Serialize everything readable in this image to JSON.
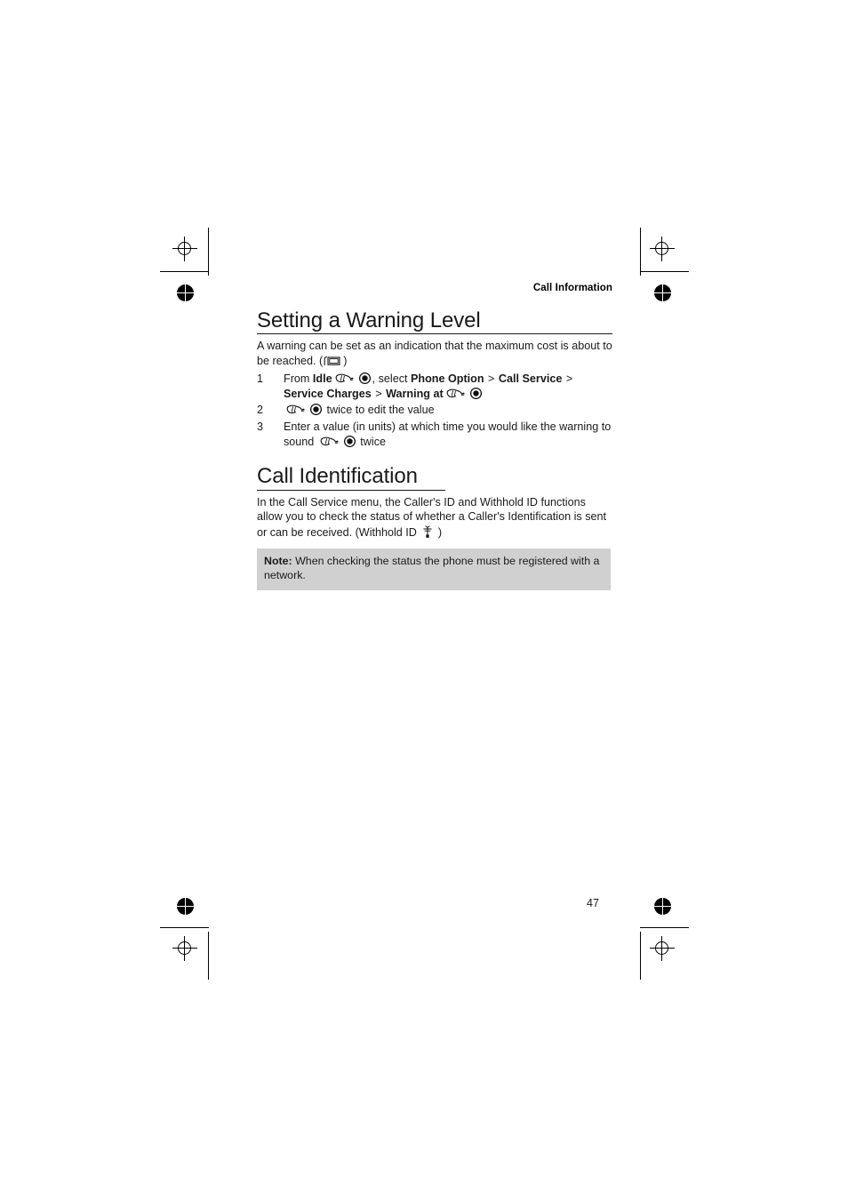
{
  "document": {
    "running_head": "Call Information",
    "page_number": "47"
  },
  "sections": [
    {
      "id": "setting-warning-level",
      "heading": "Setting a Warning Level",
      "intro_prefix": "A warning can be set as an indication that the maximum cost is about to be reached. (",
      "intro_icon": "display-icon",
      "intro_suffix": ")",
      "steps": [
        {
          "number": "1",
          "parts": [
            {
              "type": "text",
              "value": "From "
            },
            {
              "type": "bold",
              "value": "Idle"
            },
            {
              "type": "icon",
              "value": "scroll-icon"
            },
            {
              "type": "icon",
              "value": "select-icon"
            },
            {
              "type": "text",
              "value": ", select "
            },
            {
              "type": "bold",
              "value": "Phone Option"
            },
            {
              "type": "text",
              "value": " > "
            },
            {
              "type": "bold",
              "value": "Call Service"
            },
            {
              "type": "text",
              "value": " > "
            },
            {
              "type": "bold",
              "value": "Service Charges"
            },
            {
              "type": "text",
              "value": " > "
            },
            {
              "type": "bold",
              "value": "Warning at"
            },
            {
              "type": "icon",
              "value": "scroll-icon"
            },
            {
              "type": "icon",
              "value": "select-icon"
            }
          ]
        },
        {
          "number": "2",
          "parts": [
            {
              "type": "icon",
              "value": "scroll-icon"
            },
            {
              "type": "icon",
              "value": "select-icon"
            },
            {
              "type": "text",
              "value": " twice to edit the value"
            }
          ]
        },
        {
          "number": "3",
          "parts": [
            {
              "type": "text",
              "value": "Enter a value (in units) at which time you would like the warning to sound "
            },
            {
              "type": "icon",
              "value": "scroll-icon"
            },
            {
              "type": "icon",
              "value": "select-icon"
            },
            {
              "type": "text",
              "value": " twice"
            }
          ]
        }
      ]
    },
    {
      "id": "call-identification",
      "heading": "Call Identification",
      "intro_prefix": "In the Call Service menu, the Caller's ID and Withhold ID functions allow you to check the status of whether a Caller's Identification is sent or can be received. (Withhold ID",
      "intro_icon": "antenna-icon",
      "intro_suffix": ")",
      "note": {
        "label": "Note:",
        "text": " When checking the status the phone must be registered with a network."
      }
    }
  ],
  "colors": {
    "text": "#1a1a1a",
    "note_background": "#d0d0d0",
    "rule": "#1a1a1a"
  }
}
